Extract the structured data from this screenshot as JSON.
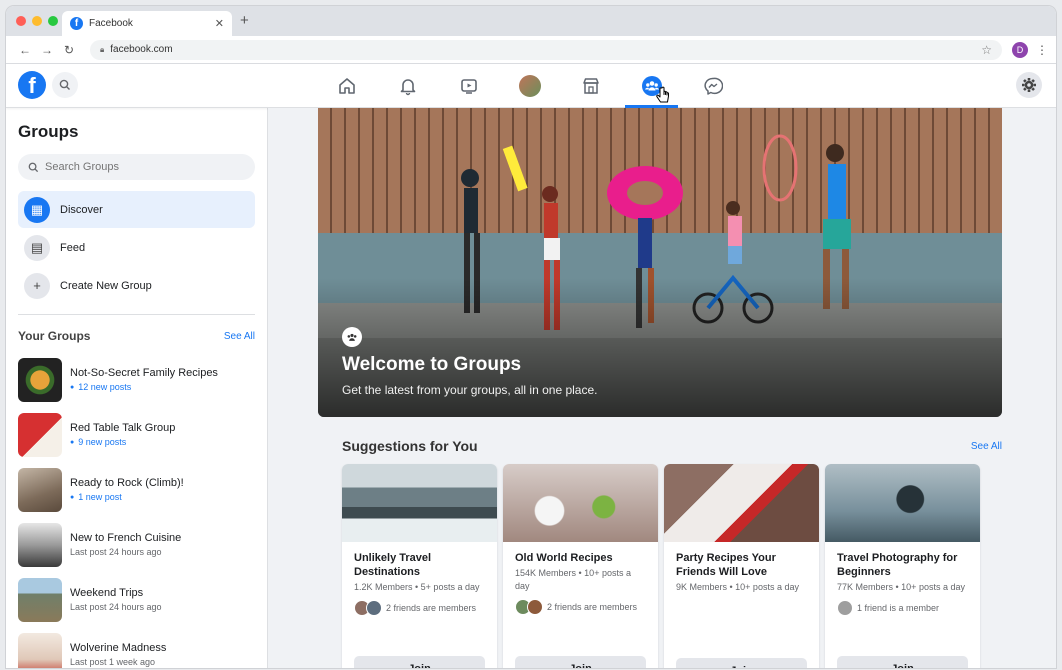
{
  "browser": {
    "tab_title": "Facebook",
    "url": "facebook.com",
    "profile_initial": "D"
  },
  "colors": {
    "brand": "#1877f2",
    "dot_red": "#ff5f57",
    "dot_yellow": "#febc2e",
    "dot_green": "#28c840"
  },
  "sidebar": {
    "title": "Groups",
    "search_placeholder": "Search Groups",
    "items": [
      {
        "label": "Discover",
        "icon": "discover-icon"
      },
      {
        "label": "Feed",
        "icon": "feed-icon"
      },
      {
        "label": "Create New Group",
        "icon": "plus-icon"
      }
    ],
    "your_groups_title": "Your Groups",
    "see_all": "See All",
    "groups": [
      {
        "name": "Not-So-Secret Family Recipes",
        "sub": "12 new posts",
        "new": true
      },
      {
        "name": "Red Table Talk Group",
        "sub": "9 new posts",
        "new": true
      },
      {
        "name": "Ready to Rock (Climb)!",
        "sub": "1 new post",
        "new": true
      },
      {
        "name": "New to French Cuisine",
        "sub": "Last post 24 hours ago",
        "new": false
      },
      {
        "name": "Weekend Trips",
        "sub": "Last post 24 hours ago",
        "new": false
      },
      {
        "name": "Wolverine Madness",
        "sub": "Last post 1 week ago",
        "new": false
      }
    ]
  },
  "hero": {
    "title": "Welcome to Groups",
    "subtitle": "Get the latest from your groups, all in one place."
  },
  "suggestions": {
    "title": "Suggestions for You",
    "see_all": "See All",
    "join_label": "Join",
    "cards": [
      {
        "name": "Unlikely Travel Destinations",
        "meta": "1.2K Members • 5+ posts a day",
        "friends": "2 friends are members"
      },
      {
        "name": "Old World Recipes",
        "meta": "154K Members • 10+ posts a day",
        "friends": "2 friends are members"
      },
      {
        "name": "Party Recipes Your Friends Will Love",
        "meta": "9K Members • 10+ posts a day",
        "friends": ""
      },
      {
        "name": "Travel Photography for Beginners",
        "meta": "77K Members • 10+ posts a day",
        "friends": "1 friend is a member"
      }
    ]
  }
}
